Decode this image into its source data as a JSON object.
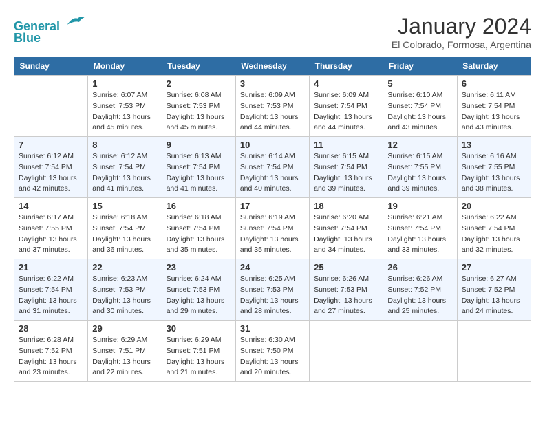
{
  "header": {
    "logo_line1": "General",
    "logo_line2": "Blue",
    "month_title": "January 2024",
    "location": "El Colorado, Formosa, Argentina"
  },
  "days_of_week": [
    "Sunday",
    "Monday",
    "Tuesday",
    "Wednesday",
    "Thursday",
    "Friday",
    "Saturday"
  ],
  "weeks": [
    [
      {
        "day": "",
        "sunrise": "",
        "sunset": "",
        "daylight": ""
      },
      {
        "day": "1",
        "sunrise": "Sunrise: 6:07 AM",
        "sunset": "Sunset: 7:53 PM",
        "daylight": "Daylight: 13 hours and 45 minutes."
      },
      {
        "day": "2",
        "sunrise": "Sunrise: 6:08 AM",
        "sunset": "Sunset: 7:53 PM",
        "daylight": "Daylight: 13 hours and 45 minutes."
      },
      {
        "day": "3",
        "sunrise": "Sunrise: 6:09 AM",
        "sunset": "Sunset: 7:53 PM",
        "daylight": "Daylight: 13 hours and 44 minutes."
      },
      {
        "day": "4",
        "sunrise": "Sunrise: 6:09 AM",
        "sunset": "Sunset: 7:54 PM",
        "daylight": "Daylight: 13 hours and 44 minutes."
      },
      {
        "day": "5",
        "sunrise": "Sunrise: 6:10 AM",
        "sunset": "Sunset: 7:54 PM",
        "daylight": "Daylight: 13 hours and 43 minutes."
      },
      {
        "day": "6",
        "sunrise": "Sunrise: 6:11 AM",
        "sunset": "Sunset: 7:54 PM",
        "daylight": "Daylight: 13 hours and 43 minutes."
      }
    ],
    [
      {
        "day": "7",
        "sunrise": "Sunrise: 6:12 AM",
        "sunset": "Sunset: 7:54 PM",
        "daylight": "Daylight: 13 hours and 42 minutes."
      },
      {
        "day": "8",
        "sunrise": "Sunrise: 6:12 AM",
        "sunset": "Sunset: 7:54 PM",
        "daylight": "Daylight: 13 hours and 41 minutes."
      },
      {
        "day": "9",
        "sunrise": "Sunrise: 6:13 AM",
        "sunset": "Sunset: 7:54 PM",
        "daylight": "Daylight: 13 hours and 41 minutes."
      },
      {
        "day": "10",
        "sunrise": "Sunrise: 6:14 AM",
        "sunset": "Sunset: 7:54 PM",
        "daylight": "Daylight: 13 hours and 40 minutes."
      },
      {
        "day": "11",
        "sunrise": "Sunrise: 6:15 AM",
        "sunset": "Sunset: 7:54 PM",
        "daylight": "Daylight: 13 hours and 39 minutes."
      },
      {
        "day": "12",
        "sunrise": "Sunrise: 6:15 AM",
        "sunset": "Sunset: 7:55 PM",
        "daylight": "Daylight: 13 hours and 39 minutes."
      },
      {
        "day": "13",
        "sunrise": "Sunrise: 6:16 AM",
        "sunset": "Sunset: 7:55 PM",
        "daylight": "Daylight: 13 hours and 38 minutes."
      }
    ],
    [
      {
        "day": "14",
        "sunrise": "Sunrise: 6:17 AM",
        "sunset": "Sunset: 7:55 PM",
        "daylight": "Daylight: 13 hours and 37 minutes."
      },
      {
        "day": "15",
        "sunrise": "Sunrise: 6:18 AM",
        "sunset": "Sunset: 7:54 PM",
        "daylight": "Daylight: 13 hours and 36 minutes."
      },
      {
        "day": "16",
        "sunrise": "Sunrise: 6:18 AM",
        "sunset": "Sunset: 7:54 PM",
        "daylight": "Daylight: 13 hours and 35 minutes."
      },
      {
        "day": "17",
        "sunrise": "Sunrise: 6:19 AM",
        "sunset": "Sunset: 7:54 PM",
        "daylight": "Daylight: 13 hours and 35 minutes."
      },
      {
        "day": "18",
        "sunrise": "Sunrise: 6:20 AM",
        "sunset": "Sunset: 7:54 PM",
        "daylight": "Daylight: 13 hours and 34 minutes."
      },
      {
        "day": "19",
        "sunrise": "Sunrise: 6:21 AM",
        "sunset": "Sunset: 7:54 PM",
        "daylight": "Daylight: 13 hours and 33 minutes."
      },
      {
        "day": "20",
        "sunrise": "Sunrise: 6:22 AM",
        "sunset": "Sunset: 7:54 PM",
        "daylight": "Daylight: 13 hours and 32 minutes."
      }
    ],
    [
      {
        "day": "21",
        "sunrise": "Sunrise: 6:22 AM",
        "sunset": "Sunset: 7:54 PM",
        "daylight": "Daylight: 13 hours and 31 minutes."
      },
      {
        "day": "22",
        "sunrise": "Sunrise: 6:23 AM",
        "sunset": "Sunset: 7:53 PM",
        "daylight": "Daylight: 13 hours and 30 minutes."
      },
      {
        "day": "23",
        "sunrise": "Sunrise: 6:24 AM",
        "sunset": "Sunset: 7:53 PM",
        "daylight": "Daylight: 13 hours and 29 minutes."
      },
      {
        "day": "24",
        "sunrise": "Sunrise: 6:25 AM",
        "sunset": "Sunset: 7:53 PM",
        "daylight": "Daylight: 13 hours and 28 minutes."
      },
      {
        "day": "25",
        "sunrise": "Sunrise: 6:26 AM",
        "sunset": "Sunset: 7:53 PM",
        "daylight": "Daylight: 13 hours and 27 minutes."
      },
      {
        "day": "26",
        "sunrise": "Sunrise: 6:26 AM",
        "sunset": "Sunset: 7:52 PM",
        "daylight": "Daylight: 13 hours and 25 minutes."
      },
      {
        "day": "27",
        "sunrise": "Sunrise: 6:27 AM",
        "sunset": "Sunset: 7:52 PM",
        "daylight": "Daylight: 13 hours and 24 minutes."
      }
    ],
    [
      {
        "day": "28",
        "sunrise": "Sunrise: 6:28 AM",
        "sunset": "Sunset: 7:52 PM",
        "daylight": "Daylight: 13 hours and 23 minutes."
      },
      {
        "day": "29",
        "sunrise": "Sunrise: 6:29 AM",
        "sunset": "Sunset: 7:51 PM",
        "daylight": "Daylight: 13 hours and 22 minutes."
      },
      {
        "day": "30",
        "sunrise": "Sunrise: 6:29 AM",
        "sunset": "Sunset: 7:51 PM",
        "daylight": "Daylight: 13 hours and 21 minutes."
      },
      {
        "day": "31",
        "sunrise": "Sunrise: 6:30 AM",
        "sunset": "Sunset: 7:50 PM",
        "daylight": "Daylight: 13 hours and 20 minutes."
      },
      {
        "day": "",
        "sunrise": "",
        "sunset": "",
        "daylight": ""
      },
      {
        "day": "",
        "sunrise": "",
        "sunset": "",
        "daylight": ""
      },
      {
        "day": "",
        "sunrise": "",
        "sunset": "",
        "daylight": ""
      }
    ]
  ]
}
